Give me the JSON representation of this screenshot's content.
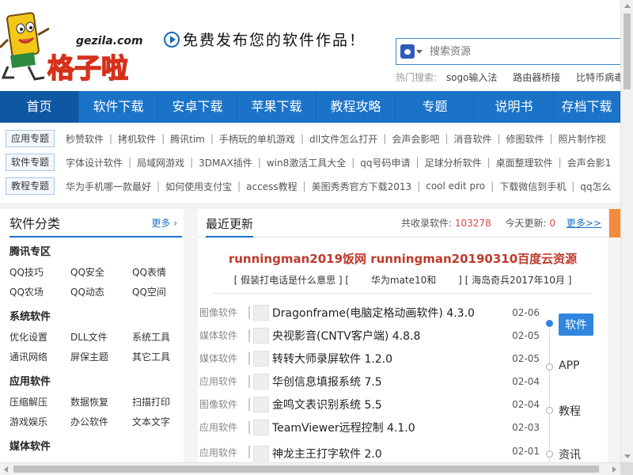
{
  "brand": {
    "domain_text": "gezila.com",
    "logo_text": "格子啦",
    "colors": {
      "primary": "#1a73c7",
      "logo_yellow": "#f3c718",
      "logo_red": "#d6301c",
      "headline_red": "#c0392b"
    }
  },
  "slogan": "免费发布您的软件作品！",
  "search": {
    "placeholder": "搜索资源",
    "engine_icon": "paw-icon"
  },
  "hot_search": {
    "label": "热门搜索:",
    "items": [
      "sogo输入法",
      "路由器桥接",
      "比特币病毒"
    ]
  },
  "nav": {
    "items": [
      {
        "label": "首页",
        "active": true
      },
      {
        "label": "软件下载"
      },
      {
        "label": "安卓下载"
      },
      {
        "label": "苹果下载"
      },
      {
        "label": "教程攻略"
      },
      {
        "label": "专题"
      },
      {
        "label": "说明书"
      },
      {
        "label": "存档下载"
      }
    ]
  },
  "topic_rows": [
    {
      "tag": "应用专题",
      "links": [
        "秒赞软件",
        "拷机软件",
        "腾讯tim",
        "手柄玩的单机游戏",
        "dll文件怎么打开",
        "会声会影吧",
        "消音软件",
        "修图软件",
        "照片制作视"
      ]
    },
    {
      "tag": "软件专题",
      "links": [
        "字体设计软件",
        "局域网游戏",
        "3DMAX插件",
        "win8激活工具大全",
        "qq号码申请",
        "足球分析软件",
        "桌面整理软件",
        "会声会影1"
      ]
    },
    {
      "tag": "教程专题",
      "links": [
        "华为手机哪一款最好",
        "如何使用支付宝",
        "access教程",
        "美图秀秀官方下载2013",
        "cool edit pro",
        "下载微信到手机",
        "qq怎么"
      ]
    }
  ],
  "sidebar": {
    "title": "软件分类",
    "more": "更多",
    "categories": [
      {
        "title": "腾讯专区",
        "items": [
          "QQ技巧",
          "QQ安全",
          "QQ表情",
          "QQ农场",
          "QQ动态",
          "QQ空间"
        ]
      },
      {
        "title": "系统软件",
        "items": [
          "优化设置",
          "DLL文件",
          "系统工具",
          "通讯网络",
          "屏保主题",
          "其它工具"
        ]
      },
      {
        "title": "应用软件",
        "items": [
          "压缩解压",
          "数据恢复",
          "扫描打印",
          "游戏娱乐",
          "办公软件",
          "文本文字"
        ]
      },
      {
        "title": "媒体软件",
        "items": []
      }
    ]
  },
  "recent": {
    "title": "最近更新",
    "total_label": "共收录软件:",
    "total_value": "103278",
    "today_label": "今天更新:",
    "today_value": "0",
    "more": "更多>>",
    "headline": "runningman2019饭网 runningman20190310百度云资源",
    "sublinks": "[ 假装打电话是什么意思 ] [ 　　华为mate10和　　 ] [ 海岛奇兵2017年10月 ]",
    "items": [
      {
        "type": "图像软件",
        "name": "Dragonframe(电脑定格动画软件) 4.3.0",
        "date": "02-06"
      },
      {
        "type": "媒体软件",
        "name": "央视影音(CNTV客户端) 4.8.8",
        "date": "02-05"
      },
      {
        "type": "媒体软件",
        "name": "转转大师录屏软件 1.2.0",
        "date": "02-05"
      },
      {
        "type": "应用软件",
        "name": "华创信息填报系统 7.5",
        "date": "02-04"
      },
      {
        "type": "图像软件",
        "name": "金鸣文表识别系统 5.5",
        "date": "02-04"
      },
      {
        "type": "应用软件",
        "name": "TeamViewer远程控制 4.1.0",
        "date": "02-03"
      },
      {
        "type": "应用软件",
        "name": "神龙主王打字软件 2.0",
        "date": "02-01"
      }
    ]
  },
  "side_tabs": [
    {
      "label": "软件",
      "active": true
    },
    {
      "label": "APP"
    },
    {
      "label": "教程"
    },
    {
      "label": "资讯"
    }
  ]
}
